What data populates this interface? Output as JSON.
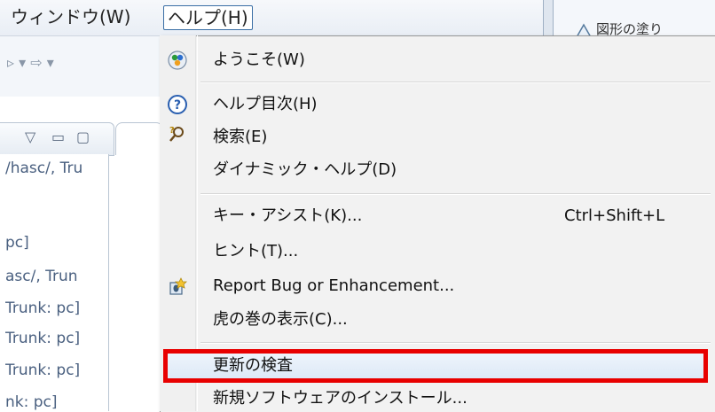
{
  "menubar": {
    "window_label": "ウィンドウ(W)",
    "help_label": "ヘルプ(H)"
  },
  "toolbar": {
    "glyphs": "▹ ▾ ⇨ ▾"
  },
  "right_editor": {
    "title": "図形の塗り"
  },
  "left_view": {
    "lines": [
      "/hasc/, Tru",
      "pc]",
      "asc/, Trun",
      "Trunk: pc]",
      "Trunk: pc]",
      "Trunk: pc]",
      "nk: pc]"
    ]
  },
  "help_menu": {
    "items": [
      {
        "label": "ようこそ(W)",
        "icon": "welcome-icon"
      },
      {
        "label": "ヘルプ目次(H)",
        "icon": "help-contents-icon"
      },
      {
        "label": "検索(E)",
        "icon": "search-help-icon"
      },
      {
        "label": "ダイナミック・ヘルプ(D)",
        "icon": ""
      },
      {
        "label": "キー・アシスト(K)...",
        "accel": "Ctrl+Shift+L"
      },
      {
        "label": "ヒント(T)..."
      },
      {
        "label": "Report Bug or Enhancement...",
        "icon": "bug-report-icon"
      },
      {
        "label": "虎の巻の表示(C)..."
      },
      {
        "label": "更新の検査"
      },
      {
        "label": "新規ソフトウェアのインストール..."
      }
    ]
  },
  "colors": {
    "highlight_border": "#e80000",
    "accent": "#3a6ea5"
  }
}
